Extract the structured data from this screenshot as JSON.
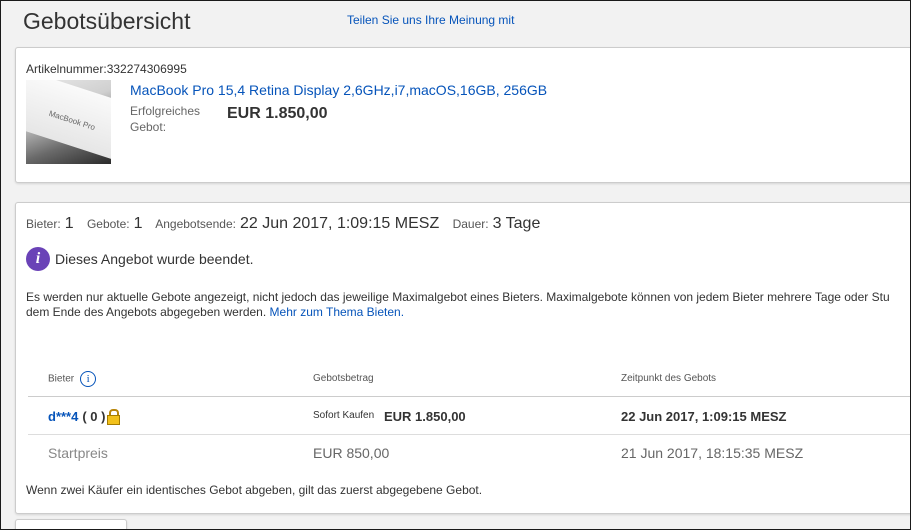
{
  "header": {
    "title": "Gebotsübersicht",
    "feedback_link": "Teilen Sie uns Ihre Meinung mit"
  },
  "item": {
    "article_number_label": "Artikelnummer:",
    "article_number": "332274306995",
    "title": "MacBook Pro 15,4 Retina Display 2,6GHz,i7,macOS,16GB, 256GB",
    "successful_bid_label": "Erfolgreiches Gebot:",
    "successful_bid_amount": "EUR 1.850,00",
    "image_text": "MacBook Pro"
  },
  "summary": {
    "bidders_label": "Bieter:",
    "bidders_value": "1",
    "bids_label": "Gebote:",
    "bids_value": "1",
    "end_label": "Angebotsende:",
    "end_value": "22 Jun 2017, 1:09:15 MESZ",
    "duration_label": "Dauer:",
    "duration_value": "3 Tage"
  },
  "ended_message": "Dieses Angebot wurde beendet.",
  "notice": {
    "text": "Es werden nur aktuelle Gebote angezeigt, nicht jedoch das jeweilige Maximalgebot eines Bieters. Maximalgebote können von jedem Bieter mehrere Tage oder Stu dem Ende des Angebots abgegeben werden. ",
    "link": "Mehr zum Thema Bieten."
  },
  "table": {
    "headers": {
      "bidder": "Bieter",
      "amount": "Gebotsbetrag",
      "time": "Zeitpunkt des Gebots"
    },
    "rows": [
      {
        "bidder": "d***4",
        "score": "( 0 )",
        "sofort": "Sofort Kaufen",
        "amount": "EUR 1.850,00",
        "time": "22 Jun 2017, 1:09:15 MESZ"
      }
    ],
    "start_row": {
      "label": "Startpreis",
      "amount": "EUR 850,00",
      "time": "21 Jun 2017, 18:15:35 MESZ"
    }
  },
  "footer_note": "Wenn zwei Käufer ein identisches Gebot abgeben, gilt das zuerst abgegebene Gebot.",
  "colors": {
    "link": "#0654ba",
    "info_badge": "#6a42b7",
    "background": "#f2f2f2"
  }
}
